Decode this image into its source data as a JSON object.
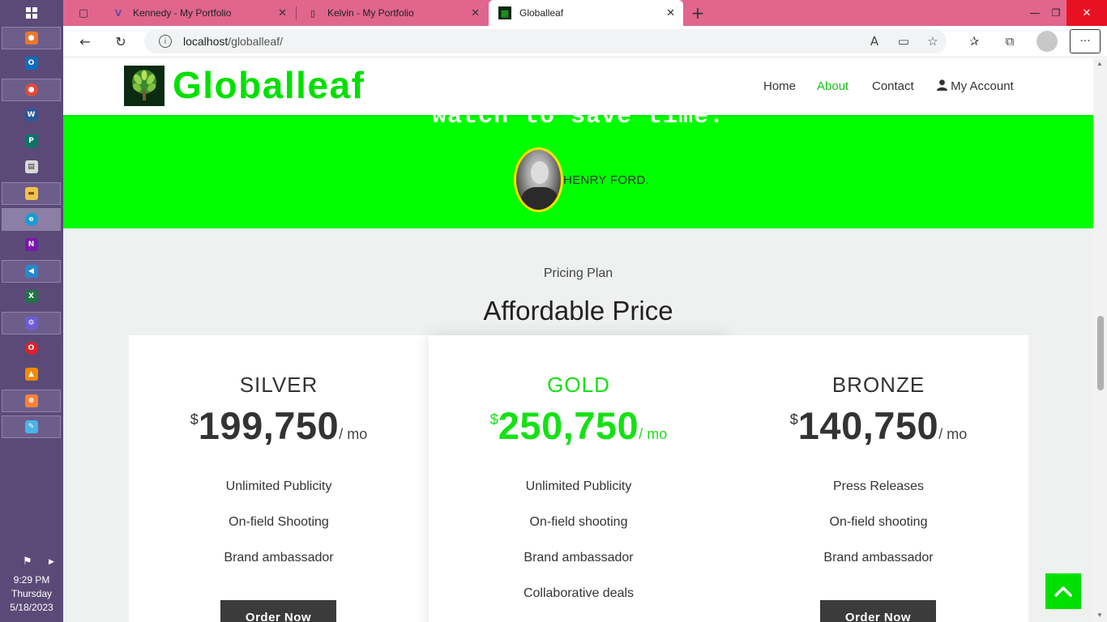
{
  "taskbar": {
    "apps": [
      {
        "name": "firefox-icon",
        "color": "#e8772e",
        "glyph": "●"
      },
      {
        "name": "outlook-icon",
        "color": "#0f6cbd",
        "glyph": "O"
      },
      {
        "name": "chrome-icon",
        "color": "#e04a3a",
        "glyph": "●"
      },
      {
        "name": "word-icon",
        "color": "#2b579a",
        "glyph": "W"
      },
      {
        "name": "publisher-icon",
        "color": "#077568",
        "glyph": "P"
      },
      {
        "name": "news-icon",
        "color": "#d8d8d8",
        "glyph": "▤"
      },
      {
        "name": "file-explorer-icon",
        "color": "#f2c14e",
        "glyph": "▬"
      },
      {
        "name": "edge-icon",
        "color": "#1c9ad6",
        "glyph": "e"
      },
      {
        "name": "onenote-icon",
        "color": "#7719aa",
        "glyph": "N"
      },
      {
        "name": "vscode-icon",
        "color": "#2489ca",
        "glyph": "◀"
      },
      {
        "name": "excel-icon",
        "color": "#217346",
        "glyph": "X"
      },
      {
        "name": "settings-icon",
        "color": "#6d5dd3",
        "glyph": "⚙"
      },
      {
        "name": "opera-icon",
        "color": "#e0202a",
        "glyph": "O"
      },
      {
        "name": "vlc-icon",
        "color": "#f08a00",
        "glyph": "▲"
      },
      {
        "name": "xampp-icon",
        "color": "#f6823a",
        "glyph": "⊗"
      },
      {
        "name": "paint-icon",
        "color": "#4bb3e6",
        "glyph": "✎"
      }
    ],
    "time": "9:29 PM",
    "day": "Thursday",
    "date": "5/18/2023"
  },
  "browser": {
    "tabs": [
      {
        "title": "Kennedy - My Portfolio",
        "icon": "V"
      },
      {
        "title": "Kelvin - My Portfolio",
        "icon": "▯"
      },
      {
        "title": "Globalleaf",
        "icon": "▦"
      }
    ],
    "url_host": "localhost",
    "url_path": "/globalleaf/"
  },
  "header": {
    "logo_text": "Globalleaf",
    "nav": [
      "Home",
      "About",
      "Contact",
      "My Account"
    ]
  },
  "hero": {
    "quote_fragment": "watch to save time.",
    "author": "HENRY FORD."
  },
  "pricing": {
    "subtitle": "Pricing Plan",
    "title": "Affordable Price",
    "currency": "$",
    "period": "/ mo",
    "order_label": "Order Now",
    "plans": [
      {
        "name": "SILVER",
        "price": "199,750",
        "features": [
          "Unlimited Publicity",
          "On-field Shooting",
          "Brand ambassador"
        ]
      },
      {
        "name": "GOLD",
        "price": "250,750",
        "features": [
          "Unlimited Publicity",
          "On-field shooting",
          "Brand ambassador",
          "Collaborative deals"
        ]
      },
      {
        "name": "BRONZE",
        "price": "140,750",
        "features": [
          "Press Releases",
          "On-field shooting",
          "Brand ambassador"
        ]
      }
    ]
  },
  "colors": {
    "accent": "#00ff00",
    "brand_text": "#00e000",
    "tab_bar": "#e0668e",
    "taskbar": "#5b4a78"
  }
}
